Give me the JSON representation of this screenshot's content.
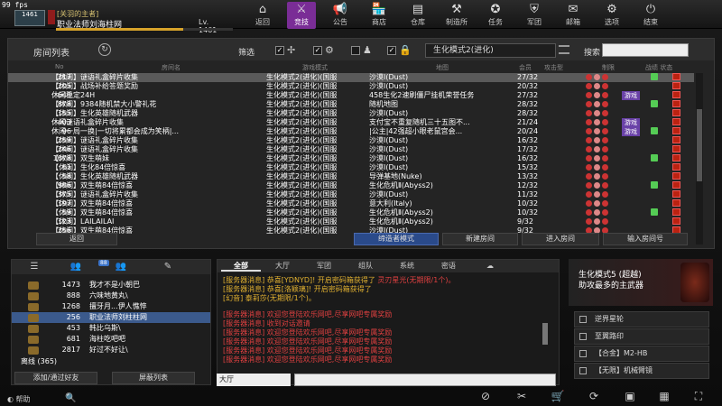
{
  "fps": "99 fps",
  "player": {
    "level_badge": "1461",
    "title": "[关羽的主者]",
    "name": "职业法师刘海柱网",
    "level_text": "Lv. 1461",
    "xp_progress": 0.72
  },
  "nav": [
    {
      "label": "返回",
      "icon": "home-icon",
      "glyph": "⌂"
    },
    {
      "label": "竞技",
      "icon": "versus-icon",
      "glyph": "⚔",
      "active": true
    },
    {
      "label": "公告",
      "icon": "megaphone-icon",
      "glyph": "📢"
    },
    {
      "label": "商店",
      "icon": "shop-icon",
      "glyph": "🏪"
    },
    {
      "label": "仓库",
      "icon": "warehouse-icon",
      "glyph": "▤"
    },
    {
      "label": "制造所",
      "icon": "factory-icon",
      "glyph": "⚒"
    },
    {
      "label": "任务",
      "icon": "mission-icon",
      "glyph": "✪"
    },
    {
      "label": "军团",
      "icon": "clan-icon",
      "glyph": "⛨"
    },
    {
      "label": "邮箱",
      "icon": "mail-icon",
      "glyph": "✉"
    },
    {
      "label": "选项",
      "icon": "gear-icon",
      "glyph": "⚙"
    },
    {
      "label": "结束",
      "icon": "power-icon",
      "glyph": "⏻"
    }
  ],
  "room_panel": {
    "title": "房间列表",
    "filter_label": "筛选",
    "mode_select": "生化模式2(进化)",
    "search_label": "搜索",
    "search_value": "",
    "columns": {
      "no": "No",
      "name": "房间名",
      "mode": "游戏模式",
      "map": "地图",
      "players": "会员",
      "attack": "攻击型",
      "weapons": "制限",
      "stats": "战绩 状态"
    }
  },
  "rooms": [
    {
      "no": "217",
      "name": "【休闲】谜语礼盒碎片收集",
      "mode": "生化模式2(进化)(国服",
      "map": "沙漠Ⅰ(Dust)",
      "players": "27/32"
    },
    {
      "no": "205",
      "name": "【休闲】战场补给答题奖励",
      "mode": "生化模式2(进化)(国服",
      "map": "沙漠Ⅰ(Dust)",
      "players": "20/32"
    },
    {
      "no": "643",
      "name": "休闲稳定24H",
      "mode": "生化模式2(进化)(国服",
      "map": "458生化2速刷僵尸挂机荣誉任务",
      "players": "27/32",
      "tag": "游戏"
    },
    {
      "no": "878",
      "name": "【休闲】9384随机禁大小警礼花",
      "mode": "生化模式2(进化)(国服",
      "map": "随机地图",
      "players": "28/32"
    },
    {
      "no": "155",
      "name": "【休闲】生化英雄随机武器",
      "mode": "生化模式2(进化)(国服",
      "map": "沙漠Ⅰ(Dust)",
      "players": "28/32"
    },
    {
      "no": "403",
      "name": "休闲谜语礼盒碎片收集",
      "mode": "生化模式2(进化)(国服",
      "map": "支付宝不重复随机三十五图不...",
      "players": "21/24",
      "tag": "游戏"
    },
    {
      "no": "96",
      "name": "休闲一局一换|一切将累都会成为笑柄|...",
      "mode": "生化模式2(进化)(国服",
      "map": "|公主|42强超小眼老鼠宫会...",
      "players": "20/24",
      "tag": "游戏"
    },
    {
      "no": "259",
      "name": "【休闲】谜语礼盒碎片收集",
      "mode": "生化模式2(进化)(国服",
      "map": "沙漠Ⅰ(Dust)",
      "players": "16/32"
    },
    {
      "no": "246",
      "name": "【休闲】谜语礼盒碎片收集",
      "mode": "生化模式2(进化)(国服",
      "map": "沙漠Ⅰ(Dust)",
      "players": "17/32"
    },
    {
      "no": "1078",
      "name": "【休闲】双生萌妹",
      "mode": "生化模式2(进化)(国服",
      "map": "沙漠Ⅰ(Dust)",
      "players": "16/32"
    },
    {
      "no": "61",
      "name": "【休闲】生化84倍惊喜",
      "mode": "生化模式2(进化)(国服",
      "map": "沙漠Ⅰ(Dust)",
      "players": "15/32"
    },
    {
      "no": "58",
      "name": "【休闲】生化英雄随机武器",
      "mode": "生化模式2(进化)(国服",
      "map": "导弹基地(Nuke)",
      "players": "13/32"
    },
    {
      "no": "986",
      "name": "【休闲】双生萌84倍惊喜",
      "mode": "生化模式2(进化)(国服",
      "map": "生化危机Ⅱ(Abyss2)",
      "players": "12/32"
    },
    {
      "no": "375",
      "name": "【休闲】谜语礼盒碎片收集",
      "mode": "生化模式2(进化)(国服",
      "map": "沙漠Ⅰ(Dust)",
      "players": "11/32"
    },
    {
      "no": "197",
      "name": "【休闲】双生萌84倍惊喜",
      "mode": "生化模式2(进化)(国服",
      "map": "意大利(Italy)",
      "players": "10/32"
    },
    {
      "no": "59",
      "name": "【休闲】双生萌84倍惊喜",
      "mode": "生化模式2(进化)(国服",
      "map": "生化危机Ⅱ(Abyss2)",
      "players": "10/32"
    },
    {
      "no": "123",
      "name": "【休闲】LAILAILAI",
      "mode": "生化模式2(进化)(国服",
      "map": "生化危机Ⅱ(Abyss2)",
      "players": "9/32"
    },
    {
      "no": "256",
      "name": "【休闲】双生萌84倍惊喜",
      "mode": "生化模式2(进化)(国服",
      "map": "沙漠Ⅰ(Dust)",
      "players": "9/32"
    }
  ],
  "actions": {
    "back": "返回",
    "observer": "缔造者模式",
    "new_room": "新建房间",
    "enter_room": "进入房间",
    "enter_number": "输入房间号"
  },
  "friends": {
    "tab_badge": "88",
    "list": [
      {
        "level": "1473",
        "name": "我才不是小朝巴"
      },
      {
        "level": "888",
        "name": "六味地黄丸\\"
      },
      {
        "level": "1268",
        "name": "擅牙月...伊人憔悴"
      },
      {
        "level": "256",
        "name": "职业法师刘柱柱网"
      },
      {
        "level": "453",
        "name": "韩比乌斯\\"
      },
      {
        "level": "681",
        "name": "海柱吃吧吧"
      },
      {
        "level": "2817",
        "name": "好过不好让\\"
      }
    ],
    "offline": "离线 (365)",
    "add_btn": "添加/通过好友",
    "block_btn": "屏蔽列表"
  },
  "chat": {
    "tabs": [
      "全部",
      "大厅",
      "军团",
      "组队",
      "系统",
      "密语",
      "☁"
    ],
    "lines": [
      {
        "prefix": "[服务器消息]",
        "text": " 恭喜[YDNYD]! 开启密码箱获得了",
        "reward": " 灵刃星光(无期限/1个)。",
        "type": "win"
      },
      {
        "prefix": "[服务器消息]",
        "text": " 恭喜[洛颖璃]! 开启密码箱获得了",
        "reward": "",
        "type": "win"
      },
      {
        "prefix": "[幻音]",
        "text": " 泰莉莎(无期限/1个)。",
        "reward": "",
        "type": "win"
      },
      {
        "prefix": "[服务器消息]",
        "text": " 欢迎您登陆欢乐网吧,尽享网吧专属奖励",
        "reward": "",
        "type": "sys"
      },
      {
        "prefix": "[服务器消息]",
        "text": " 收到对话邀请",
        "reward": "",
        "type": "sys"
      },
      {
        "prefix": "[服务器消息]",
        "text": " 欢迎您登陆欢乐网吧,尽享网吧专属奖励",
        "reward": "",
        "type": "sys"
      },
      {
        "prefix": "[服务器消息]",
        "text": " 欢迎您登陆欢乐网吧,尽享网吧专属奖励",
        "reward": "",
        "type": "sys"
      },
      {
        "prefix": "[服务器消息]",
        "text": " 欢迎您登陆欢乐网吧,尽享网吧专属奖励",
        "reward": "",
        "type": "sys"
      },
      {
        "prefix": "[服务器消息]",
        "text": " 欢迎您登陆欢乐网吧,尽享网吧专属奖励",
        "reward": "",
        "type": "sys"
      }
    ],
    "channel": "大厅",
    "input_value": ""
  },
  "promo": {
    "title": "生化模式5 (超越)",
    "subtitle": "助攻最多的主武器"
  },
  "items": [
    "逆界星轮",
    "至翼路印",
    "【合金】M2-HB",
    "【无限】机械臂镜"
  ],
  "help": "帮助"
}
